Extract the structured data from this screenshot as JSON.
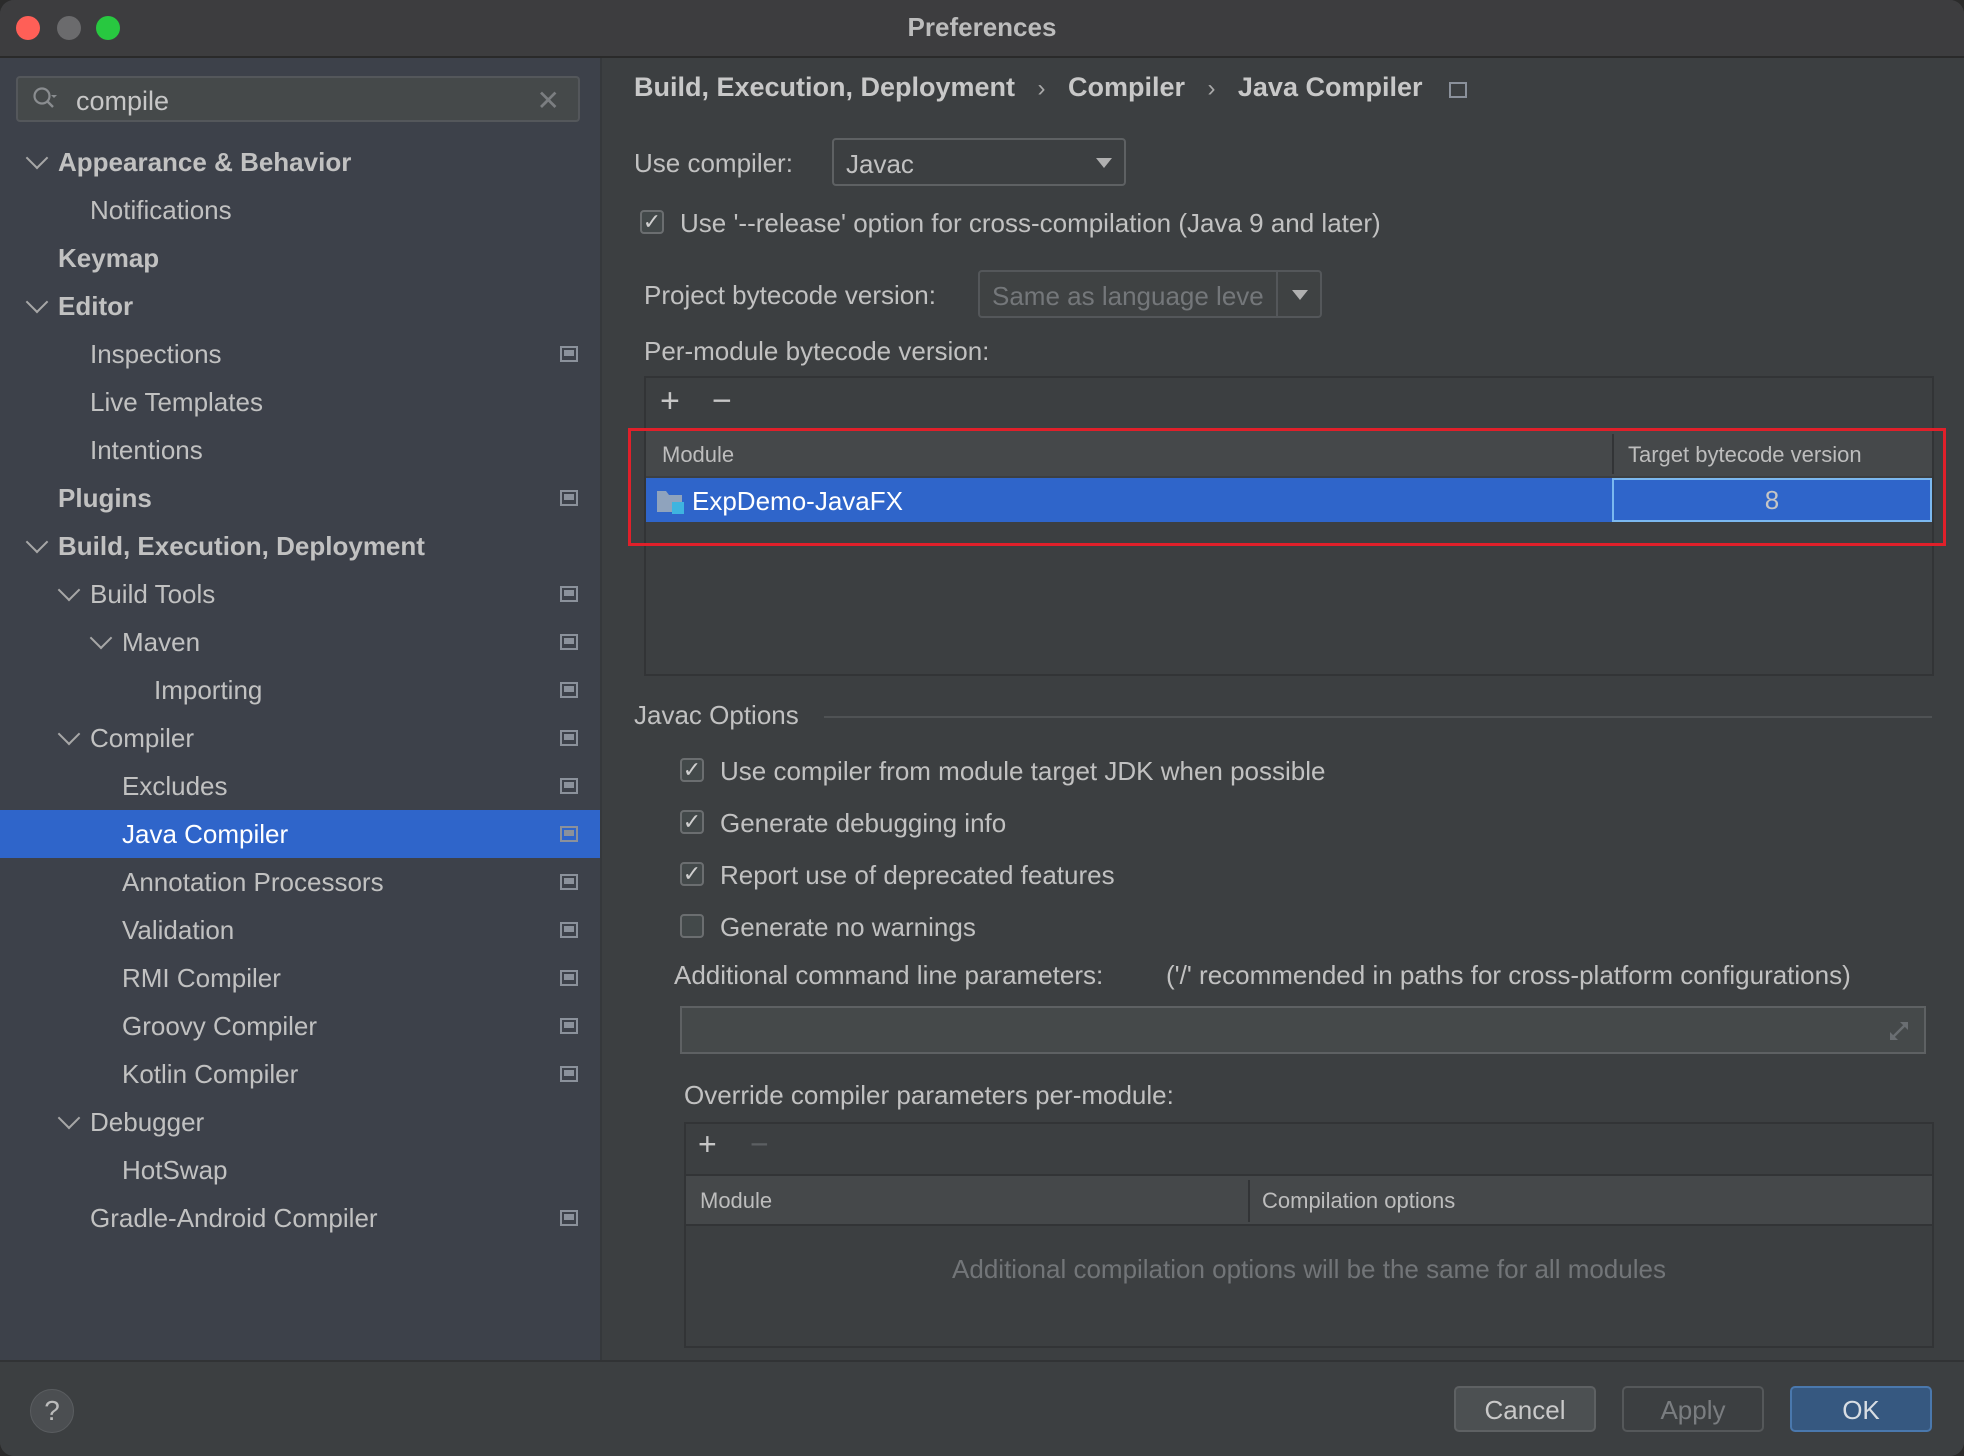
{
  "window": {
    "title": "Preferences",
    "traffic_lights": {
      "close": "#ff5f57",
      "minimize": "#6b6b6d",
      "zoom": "#28c840"
    }
  },
  "sidebar": {
    "search": {
      "value": "compile",
      "icon": "search-icon",
      "clear_icon": "close-icon"
    },
    "items": [
      {
        "label": "Appearance & Behavior",
        "level": 0,
        "bold": true,
        "expanded": true,
        "project_badge": false
      },
      {
        "label": "Notifications",
        "level": 1,
        "bold": false,
        "project_badge": false
      },
      {
        "label": "Keymap",
        "level": 0,
        "bold": true,
        "project_badge": false
      },
      {
        "label": "Editor",
        "level": 0,
        "bold": true,
        "expanded": true,
        "project_badge": false
      },
      {
        "label": "Inspections",
        "level": 1,
        "bold": false,
        "project_badge": true
      },
      {
        "label": "Live Templates",
        "level": 1,
        "bold": false,
        "project_badge": false
      },
      {
        "label": "Intentions",
        "level": 1,
        "bold": false,
        "project_badge": false
      },
      {
        "label": "Plugins",
        "level": 0,
        "bold": true,
        "project_badge": true
      },
      {
        "label": "Build, Execution, Deployment",
        "level": 0,
        "bold": true,
        "expanded": true,
        "project_badge": false
      },
      {
        "label": "Build Tools",
        "level": 1,
        "bold": false,
        "expanded": true,
        "project_badge": true
      },
      {
        "label": "Maven",
        "level": 2,
        "bold": false,
        "expanded": true,
        "project_badge": true
      },
      {
        "label": "Importing",
        "level": 3,
        "bold": false,
        "project_badge": true
      },
      {
        "label": "Compiler",
        "level": 1,
        "bold": false,
        "expanded": true,
        "project_badge": true
      },
      {
        "label": "Excludes",
        "level": 2,
        "bold": false,
        "project_badge": true
      },
      {
        "label": "Java Compiler",
        "level": 2,
        "bold": false,
        "selected": true,
        "project_badge": true
      },
      {
        "label": "Annotation Processors",
        "level": 2,
        "bold": false,
        "project_badge": true
      },
      {
        "label": "Validation",
        "level": 2,
        "bold": false,
        "project_badge": true
      },
      {
        "label": "RMI Compiler",
        "level": 2,
        "bold": false,
        "project_badge": true
      },
      {
        "label": "Groovy Compiler",
        "level": 2,
        "bold": false,
        "project_badge": true
      },
      {
        "label": "Kotlin Compiler",
        "level": 2,
        "bold": false,
        "project_badge": true
      },
      {
        "label": "Debugger",
        "level": 1,
        "bold": false,
        "expanded": true,
        "project_badge": false
      },
      {
        "label": "HotSwap",
        "level": 2,
        "bold": false,
        "project_badge": false
      },
      {
        "label": "Gradle-Android Compiler",
        "level": 1,
        "bold": false,
        "project_badge": true
      }
    ]
  },
  "main": {
    "breadcrumb": [
      "Build, Execution, Deployment",
      "Compiler",
      "Java Compiler"
    ],
    "breadcrumb_sep": "›",
    "use_compiler": {
      "label": "Use compiler:",
      "value": "Javac"
    },
    "release_option": {
      "label": "Use '--release' option for cross-compilation (Java 9 and later)",
      "checked": true
    },
    "project_bytecode": {
      "label": "Project bytecode version:",
      "placeholder": "Same as language leve"
    },
    "per_module": {
      "label": "Per-module bytecode version:",
      "add_icon": "+",
      "remove_icon": "−",
      "columns": [
        "Module",
        "Target bytecode version"
      ],
      "rows": [
        {
          "module": "ExpDemo-JavaFX",
          "target": "8",
          "selected": true
        }
      ]
    },
    "javac_options": {
      "section_title": "Javac Options",
      "checkboxes": [
        {
          "label": "Use compiler from module target JDK when possible",
          "checked": true
        },
        {
          "label": "Generate debugging info",
          "checked": true
        },
        {
          "label": "Report use of deprecated features",
          "checked": true
        },
        {
          "label": "Generate no warnings",
          "checked": false
        }
      ],
      "additional_params_label": "Additional command line parameters:",
      "additional_params_hint": "('/' recommended in paths for cross-platform configurations)",
      "additional_params_value": "",
      "override_label": "Override compiler parameters per-module:",
      "override_table": {
        "add_icon": "+",
        "remove_icon": "−",
        "columns": [
          "Module",
          "Compilation options"
        ],
        "empty_text": "Additional compilation options will be the same for all modules"
      }
    },
    "highlight_color": "#e0202a",
    "selection_color": "#2f65ca"
  },
  "footer": {
    "help": "?",
    "cancel": "Cancel",
    "apply": "Apply",
    "ok": "OK"
  }
}
